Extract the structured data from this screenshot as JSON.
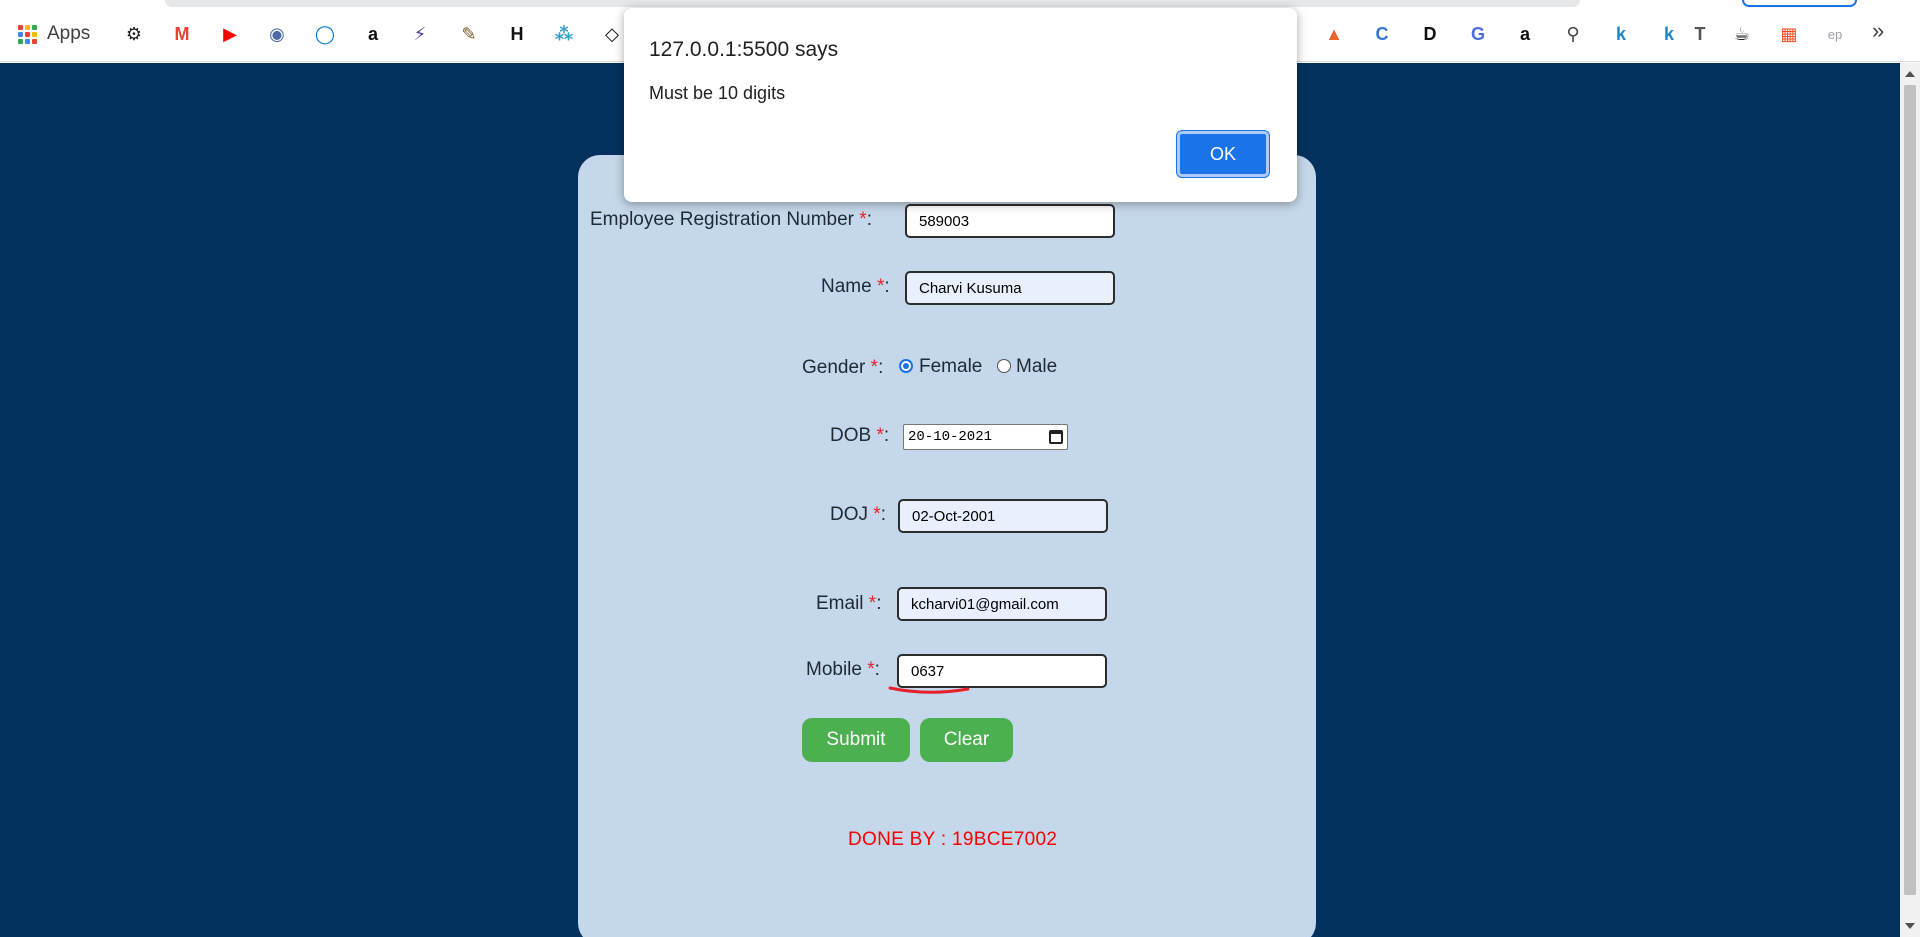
{
  "bookmarks": {
    "apps_label": "Apps",
    "items": [
      {
        "icon": "gear-icon",
        "glyph": "⚙",
        "color": "#222222"
      },
      {
        "icon": "gmail-icon",
        "glyph": "M",
        "color": "#ea4335"
      },
      {
        "icon": "youtube-icon",
        "glyph": "▶",
        "color": "#ff0000"
      },
      {
        "icon": "emblem-icon",
        "glyph": "◉",
        "color": "#4a6aa5"
      },
      {
        "icon": "dell-icon",
        "glyph": "◯",
        "color": "#0076ce"
      },
      {
        "icon": "amazon-icon",
        "glyph": "a",
        "color": "#111111"
      },
      {
        "icon": "lightning-icon",
        "glyph": "⚡",
        "color": "#5b3fa0"
      },
      {
        "icon": "cat-icon",
        "glyph": "✎",
        "color": "#7a5a2a"
      },
      {
        "icon": "hackerrank-icon",
        "glyph": "H",
        "color": "#111111"
      },
      {
        "icon": "graph-icon",
        "glyph": "⁂",
        "color": "#34a0c9"
      },
      {
        "icon": "diamond-icon",
        "glyph": "◇",
        "color": "#111111"
      },
      {
        "icon": "matlab-icon",
        "glyph": "▲",
        "color": "#e8622a"
      },
      {
        "icon": "c-icon",
        "glyph": "C",
        "color": "#3474d4"
      },
      {
        "icon": "dev-icon",
        "glyph": "D",
        "color": "#111111"
      },
      {
        "icon": "g-badge-icon",
        "glyph": "G",
        "color": "#4a6ce0"
      },
      {
        "icon": "amazon-icon",
        "glyph": "a",
        "color": "#111111"
      },
      {
        "icon": "magnifier-icon",
        "glyph": "⚲",
        "color": "#444444"
      },
      {
        "icon": "k-icon",
        "glyph": "k",
        "color": "#1e88c8"
      },
      {
        "icon": "k-icon",
        "glyph": "k",
        "color": "#1e88c8"
      },
      {
        "icon": "t-icon",
        "glyph": "T",
        "color": "#555555"
      },
      {
        "icon": "java-icon",
        "glyph": "☕",
        "color": "#222222"
      },
      {
        "icon": "microsoft-icon",
        "glyph": "▦",
        "color": "#f25022"
      },
      {
        "icon": "ep-icon",
        "glyph": "ep",
        "color": "#9aa0a6"
      }
    ],
    "overflow_glyph": "»"
  },
  "dialog": {
    "title": "127.0.0.1:5500 says",
    "message": "Must be 10 digits",
    "ok_label": "OK"
  },
  "form": {
    "required_mark": "*",
    "fields": {
      "emp_reg": {
        "label": "Employee Registration Number",
        "value": "589003"
      },
      "name": {
        "label": "Name",
        "value": "Charvi Kusuma"
      },
      "gender": {
        "label": "Gender",
        "options": [
          "Female",
          "Male"
        ],
        "selected": "Female"
      },
      "dob": {
        "label": "DOB",
        "value": "20-10-2021"
      },
      "doj": {
        "label": "DOJ",
        "value": "02-Oct-2001"
      },
      "email": {
        "label": "Email",
        "value": "kcharvi01@gmail.com"
      },
      "mobile": {
        "label": "Mobile",
        "value": "0637"
      }
    },
    "submit_label": "Submit",
    "clear_label": "Clear",
    "footer": "DONE BY : 19BCE7002"
  },
  "colors": {
    "page_bg": "#04325e",
    "card_bg": "#c5d7ea",
    "button_green": "#4caf50",
    "required_red": "#e8202a",
    "footer_red": "#ff0000",
    "dialog_blue": "#1a73e8"
  }
}
